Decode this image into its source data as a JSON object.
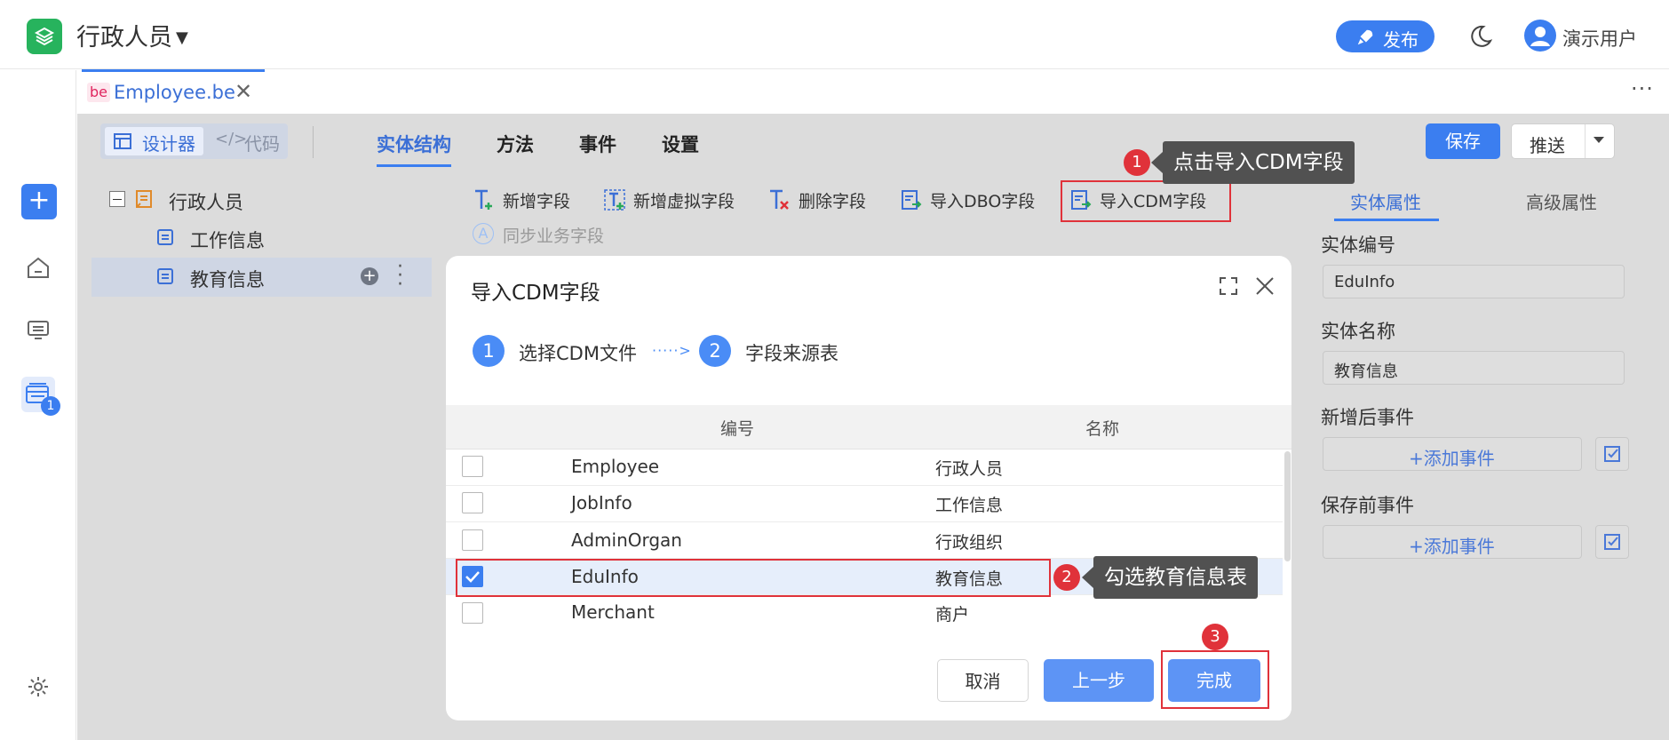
{
  "app": {
    "title": "行政人员",
    "publish_label": "发布",
    "user_name": "演示用户"
  },
  "rail": {
    "badge_count": "1"
  },
  "file_tab": {
    "tag": "be",
    "name": "Employee.be",
    "close": "✕",
    "more": "···"
  },
  "view_switch": {
    "designer": "设计器",
    "code": "代码"
  },
  "main_tabs": [
    {
      "label": "实体结构"
    },
    {
      "label": "方法"
    },
    {
      "label": "事件"
    },
    {
      "label": "设置"
    }
  ],
  "toolbar_buttons": {
    "save": "保存",
    "push": "推送"
  },
  "tree": {
    "root": "行政人员",
    "children": [
      {
        "label": "工作信息"
      },
      {
        "label": "教育信息"
      }
    ]
  },
  "field_actions": [
    {
      "label": "新增字段"
    },
    {
      "label": "新增虚拟字段"
    },
    {
      "label": "删除字段"
    },
    {
      "label": "导入DBO字段"
    },
    {
      "label": "导入CDM字段"
    },
    {
      "label": "同步业务字段"
    }
  ],
  "right_panel": {
    "tabs": [
      {
        "label": "实体属性"
      },
      {
        "label": "高级属性"
      }
    ],
    "entity_code_label": "实体编号",
    "entity_code_value": "EduInfo",
    "entity_name_label": "实体名称",
    "entity_name_value": "教育信息",
    "after_add_label": "新增后事件",
    "before_save_label": "保存前事件",
    "add_event": "+添加事件"
  },
  "dialog": {
    "title": "导入CDM字段",
    "steps": [
      {
        "num": "1",
        "label": "选择CDM文件"
      },
      {
        "num": "2",
        "label": "字段来源表"
      }
    ],
    "step_arrow": "·····>",
    "columns": {
      "code": "编号",
      "name": "名称"
    },
    "rows": [
      {
        "code": "Employee",
        "name": "行政人员",
        "checked": false
      },
      {
        "code": "JobInfo",
        "name": "工作信息",
        "checked": false
      },
      {
        "code": "AdminOrgan",
        "name": "行政组织",
        "checked": false
      },
      {
        "code": "EduInfo",
        "name": "教育信息",
        "checked": true
      },
      {
        "code": "Merchant",
        "name": "商户",
        "checked": false
      }
    ],
    "buttons": {
      "cancel": "取消",
      "prev": "上一步",
      "done": "完成"
    }
  },
  "annotations": [
    {
      "num": "1",
      "text": "点击导入CDM字段"
    },
    {
      "num": "2",
      "text": "勾选教育信息表"
    },
    {
      "num": "3"
    }
  ],
  "colors": {
    "accent": "#3b7ef0",
    "annotation_red": "#e0323a",
    "brand_green": "#27b35d"
  }
}
